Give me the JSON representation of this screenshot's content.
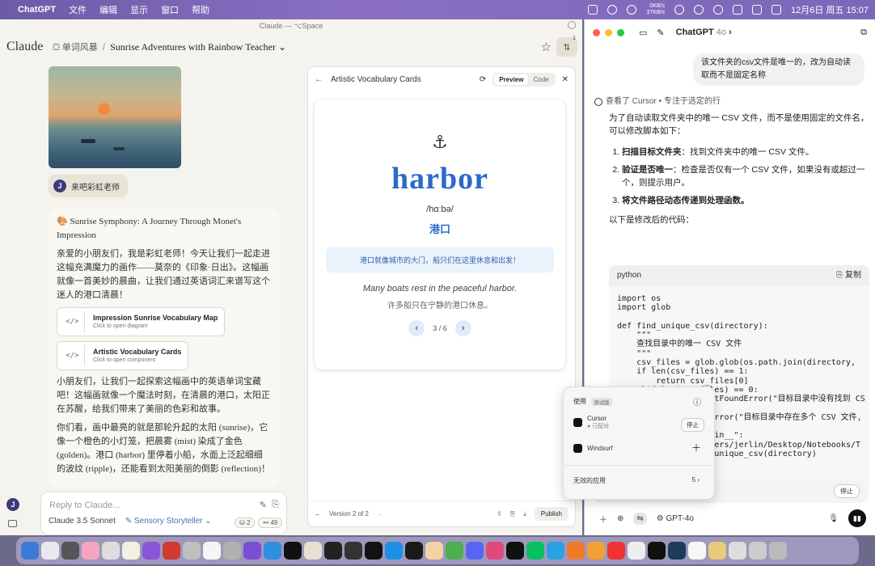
{
  "menubar": {
    "app": "ChatGPT",
    "items": [
      "文件",
      "编辑",
      "显示",
      "窗口",
      "帮助"
    ],
    "net_up": "0KB/s",
    "net_down": "37KB/s",
    "datetime": "12月6日 周五 15:07"
  },
  "claude": {
    "window_title": "Claude — ⌥Space",
    "brand": "Claude",
    "project": "单词风暴",
    "conversation_title": "Sunrise Adventures with Rainbow Teacher",
    "header_badge": "1",
    "user_initial": "J",
    "user_message": "来吧彩虹老师",
    "reply_heading": "🎨 Sunrise Symphony: A Journey Through Monet's Impression",
    "reply_p1": "亲爱的小朋友们，我是彩虹老师！今天让我们一起走进这幅充满魔力的画作——莫奈的《印象·日出》。这幅画就像一首美妙的晨曲，让我们通过英语词汇来谱写这个迷人的港口清晨！",
    "artifact1_title": "Impression Sunrise Vocabulary Map",
    "artifact1_sub": "Click to open diagram",
    "artifact2_title": "Artistic Vocabulary Cards",
    "artifact2_sub": "Click to open component",
    "reply_p2": "小朋友们，让我们一起探索这幅画中的英语单词宝藏吧！这幅画就像一个魔法时刻，在清晨的港口，太阳正在苏醒，给我们带来了美丽的色彩和故事。",
    "reply_p3": "你们看，画中最亮的就是那轮升起的太阳 (sunrise)，它像一个橙色的小灯笼，把晨雾 (mist) 染成了金色 (golden)。港口 (harbor) 里停着小船，水面上泛起细细的波纹 (ripple)，还能看到太阳美丽的倒影 (reflection)！",
    "input_placeholder": "Reply to Claude...",
    "model": "Claude 3.5 Sonnet",
    "style": "Sensory Storyteller",
    "pill1": "2",
    "pill2": "49",
    "code_icon": "</>"
  },
  "artifact": {
    "title": "Artistic Vocabulary Cards",
    "tab_preview": "Preview",
    "tab_code": "Code",
    "icon": "⚓",
    "word": "harbor",
    "phonetic": "/hɑːbə/",
    "chinese": "港口",
    "note": "港口就像城市的大门，船只们在这里休息和出发！",
    "example": "Many boats rest in the peaceful harbor.",
    "example_cn": "许多船只在宁静的港口休息。",
    "page": "3 / 6",
    "version": "Version 2 of 2",
    "publish": "Publish"
  },
  "gpt": {
    "title": "ChatGPT",
    "model_short": "4o",
    "user_msg": "该文件夹的csv文件是唯一的，改为自动读取而不是固定名称",
    "thought": "查看了 Cursor • 专注于选定的行",
    "answer_intro": "为了自动读取文件夹中的唯一 CSV 文件，而不是使用固定的文件名，可以修改脚本如下：",
    "step1_b": "扫描目标文件夹",
    "step1_t": "：找到文件夹中的唯一 CSV 文件。",
    "step2_b": "验证是否唯一",
    "step2_t": "：检查是否仅有一个 CSV 文件，如果没有或超过一个，则提示用户。",
    "step3_b": "将文件路径动态传递到处理函数。",
    "code_intro": "以下是修改后的代码：",
    "code_lang": "python",
    "copy": "复制",
    "code": "import os\nimport glob\n\ndef find_unique_csv(directory):\n    \"\"\"\n    查找目录中的唯一 CSV 文件\n    \"\"\"\n    csv_files = glob.glob(os.path.join(directory,\n    if len(csv_files) == 1:\n        return csv_files[0]\n    elif len(csv_files) == 0:\n        raise FileNotFoundError(\"目标目录中没有找到 CS\n    else:\n        raise ValueError(\"目标目录中存在多个 CSV 文件,\n\nif __name__ == \"__main__\":\n    directory = \"/Users/jerlin/Desktop/Notebooks/T\n    csv_file = find_unique_csv(directory)",
    "stop": "停止",
    "model_btn": "GPT-4o"
  },
  "popup": {
    "use_label": "使用",
    "beta": "测试版",
    "app1": "Cursor",
    "app1_status": "已配对",
    "stop": "停止",
    "app2": "Windsurf",
    "invalid": "无效的应用",
    "invalid_count": "5"
  }
}
